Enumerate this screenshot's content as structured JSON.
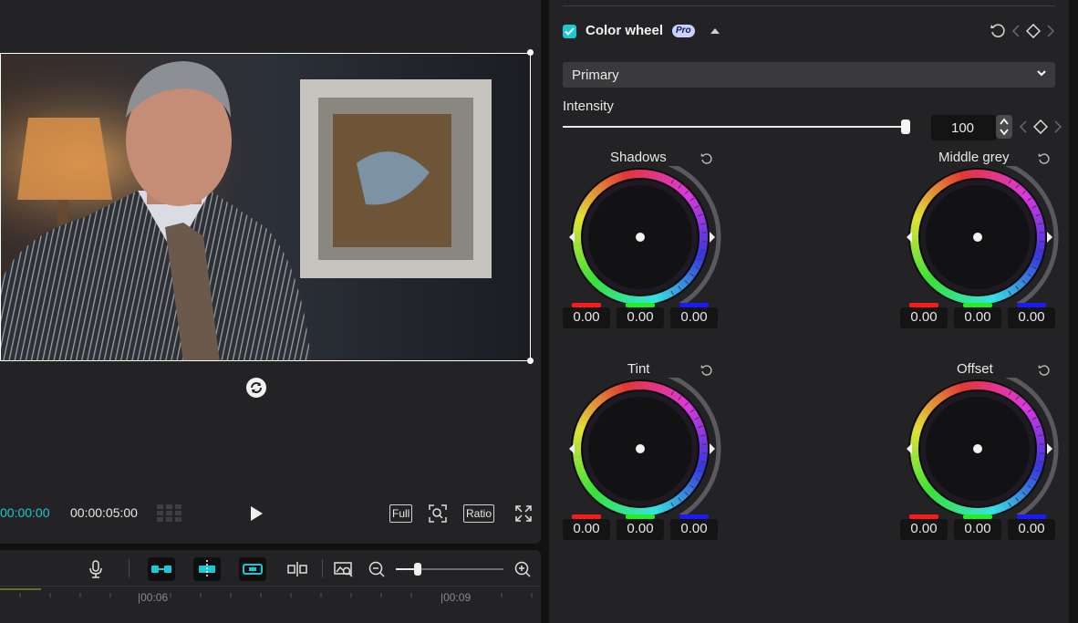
{
  "player": {
    "timecode_current": "00:00:00",
    "timecode_total": "00:00:05:00",
    "full_label": "Full",
    "ratio_label": "Ratio"
  },
  "timeline": {
    "ruler_labels": [
      "|00:06",
      "|00:09"
    ],
    "zoom_level": 0.2
  },
  "color_wheel": {
    "title": "Color wheel",
    "badge": "Pro",
    "enabled": true,
    "mode": "Primary",
    "intensity_label": "Intensity",
    "intensity_value": "100",
    "wheels": [
      {
        "name": "Shadows",
        "r": "0.00",
        "g": "0.00",
        "b": "0.00"
      },
      {
        "name": "Middle grey",
        "r": "0.00",
        "g": "0.00",
        "b": "0.00"
      },
      {
        "name": "Tint",
        "r": "0.00",
        "g": "0.00",
        "b": "0.00"
      },
      {
        "name": "Offset",
        "r": "0.00",
        "g": "0.00",
        "b": "0.00"
      }
    ]
  },
  "colors": {
    "accent": "#1fc7d4",
    "panel_bg": "#232325",
    "red_bar": "#ff1a1a",
    "green_bar": "#22ee22",
    "blue_bar": "#1a1aff"
  }
}
